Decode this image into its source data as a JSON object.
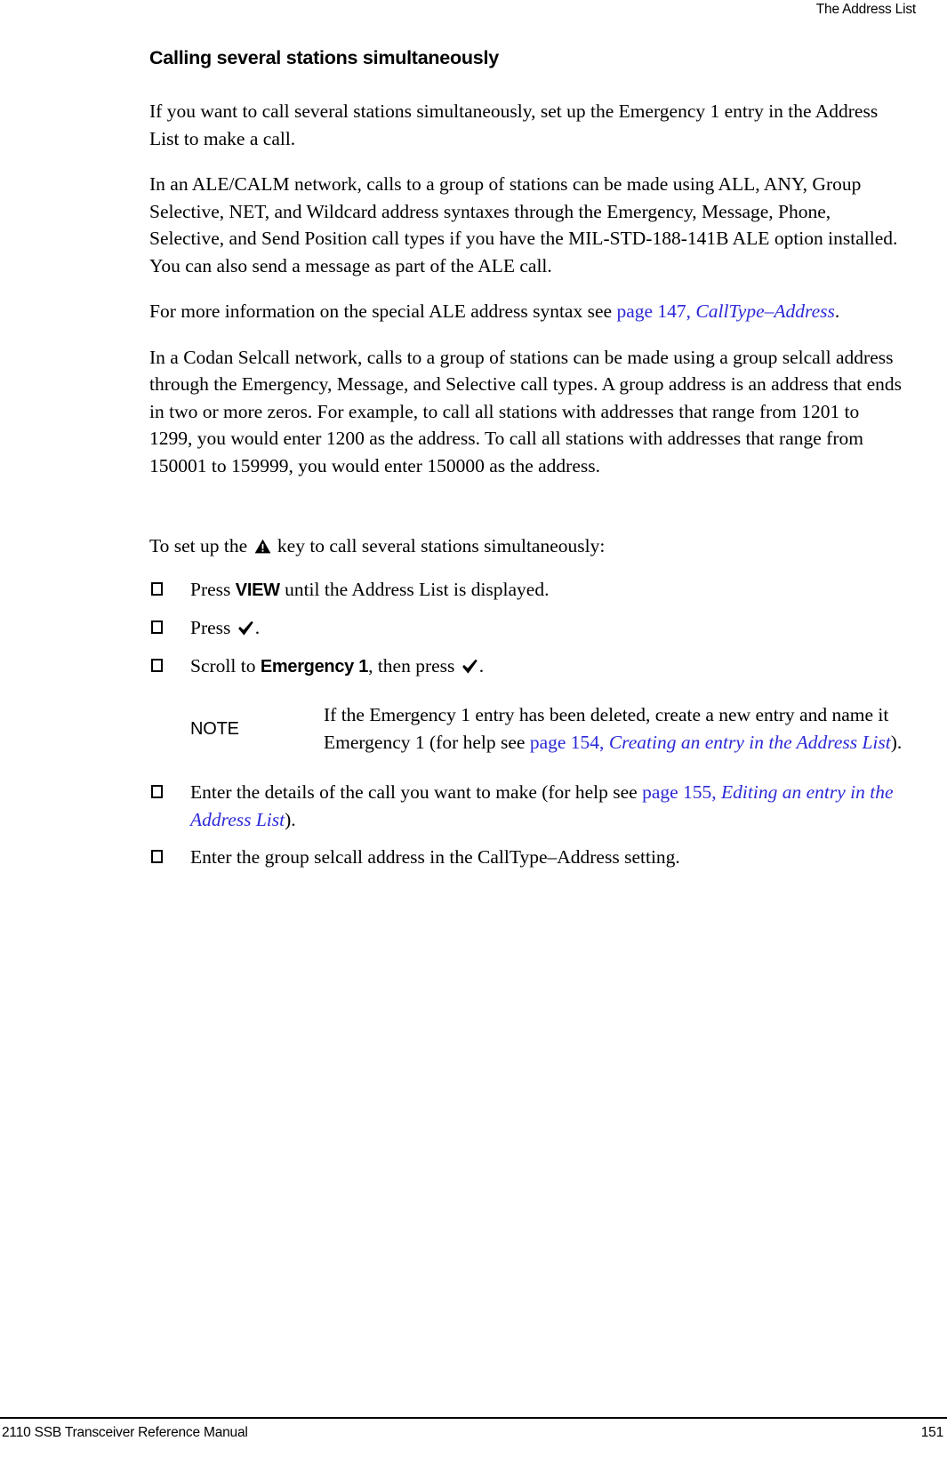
{
  "header": {
    "running_head": "The Address List"
  },
  "section": {
    "title": "Calling several stations simultaneously"
  },
  "paragraphs": {
    "p1": "If you want to call several stations simultaneously, set up the Emergency 1 entry in the Address List to make a call.",
    "p2": "In an ALE/CALM network, calls to a group of stations can be made using ALL, ANY, Group Selective, NET, and Wildcard address syntaxes through the Emergency, Message, Phone, Selective, and Send Position call types if you have the MIL-STD-188-141B ALE option installed. You can also send a message as part of the ALE call.",
    "p3_before_link": "For more information on the special ALE address syntax see ",
    "p3_link_page": "page 147, ",
    "p3_link_title": "CallType–Address",
    "p3_after_link": ".",
    "p4": "In a Codan Selcall network, calls to a group of stations can be made using a group selcall address through the Emergency, Message, and Selective call types. A group address is an address that ends in two or more zeros. For example, to call all stations with addresses that range from 1201 to 1299, you would enter 1200 as the address. To call all stations with addresses that range from 150001 to 159999, you would enter 150000 as the address."
  },
  "procedure": {
    "lead_in_before_icon": "To set up the ",
    "lead_in_icon": "warning-triangle-icon",
    "lead_in_after_icon": " key to call several stations simultaneously:",
    "steps": [
      {
        "before_bold": "Press ",
        "bold": "VIEW",
        "after_bold": " until the Address List is displayed."
      },
      {
        "before_bold": "Press ",
        "bold": "",
        "after_bold": "."
      },
      {
        "before_bold": "Scroll to ",
        "bold": "Emergency 1",
        "after_bold": ", then press "
      }
    ],
    "step2_text": "Press ",
    "step2_tail": ".",
    "step3_before": "Scroll to ",
    "step3_bold": "Emergency 1",
    "step3_mid": ", then press ",
    "step3_tail": ".",
    "step4_before_link": "Enter the details of the call you want to make (for help see ",
    "step4_link_page": "page 155, ",
    "step4_link_title": "Editing an entry in the Address List",
    "step4_after_link": ").",
    "step5": "Enter the group selcall address in the CallType–Address setting."
  },
  "note": {
    "label": "NOTE",
    "text_before_link": "If the Emergency 1 entry has been deleted, create a new entry and name it Emergency 1 (for help see ",
    "link_page": "page 154, ",
    "link_title": "Creating an entry in the Address List",
    "text_after_link": ")."
  },
  "footer": {
    "manual_title": "2110 SSB Transceiver Reference Manual",
    "page_number": "151"
  },
  "colors": {
    "link": "#2b28d6",
    "text": "#000000",
    "background": "#ffffff"
  }
}
